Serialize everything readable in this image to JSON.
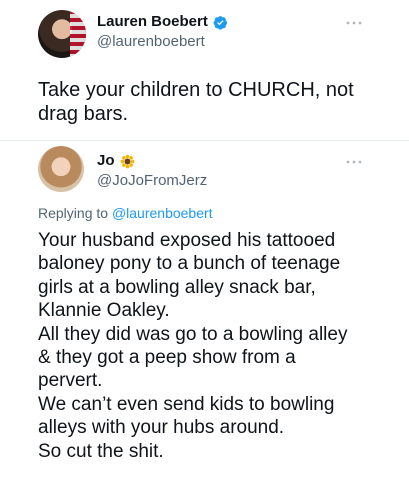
{
  "main_tweet": {
    "author_name": "Lauren Boebert",
    "author_handle": "@laurenboebert",
    "verified": true,
    "text": "Take your children to CHURCH, not\ndrag bars."
  },
  "reply_tweet": {
    "author_name": "Jo",
    "author_emoji": "sunflower",
    "author_handle": "@JoJoFromJerz",
    "replying_prefix": "Replying to",
    "replying_mention": "@laurenboebert",
    "text": "Your husband exposed his tattooed\nbaloney pony to a bunch of teenage\ngirls at a bowling alley snack bar,\nKlannie Oakley.\nAll they did was go to a bowling alley\n& they got a peep show from a\npervert.\nWe can’t even send kids to bowling\nalleys with your hubs around.\nSo cut the shit."
  },
  "colors": {
    "text_primary": "#0f1419",
    "text_secondary": "#536471",
    "link": "#1d9bf0",
    "verified_badge": "#1d9bf0",
    "divider": "#e6ecf0"
  },
  "icons": {
    "more": "more-horizontal-icon",
    "verified": "verified-badge-icon",
    "emoji": "sunflower-emoji-icon"
  }
}
